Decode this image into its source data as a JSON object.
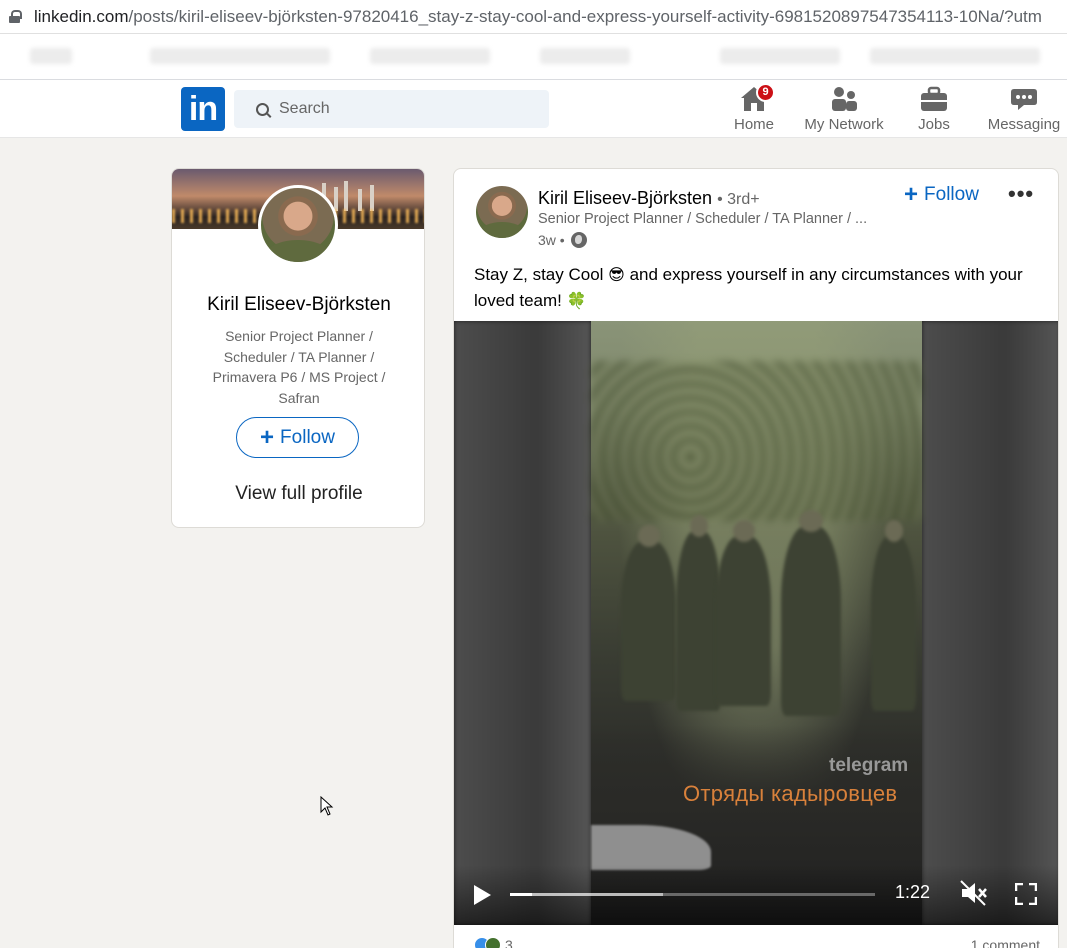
{
  "browser": {
    "url_host": "linkedin.com",
    "url_path": "/posts/kiril-eliseev-björksten-97820416_stay-z-stay-cool-and-express-yourself-activity-6981520897547354113-10Na/?utm"
  },
  "nav": {
    "logo_text": "in",
    "search_placeholder": "Search",
    "items": [
      {
        "label": "Home",
        "icon": "home-icon",
        "badge": "9"
      },
      {
        "label": "My Network",
        "icon": "network-icon"
      },
      {
        "label": "Jobs",
        "icon": "briefcase-icon"
      },
      {
        "label": "Messaging",
        "icon": "chat-icon"
      }
    ],
    "brand_color": "#0a66c2",
    "badge_color": "#cc1016"
  },
  "profile_card": {
    "name": "Kiril Eliseev-Björksten",
    "headline": "Senior Project Planner / Scheduler / TA Planner / Primavera P6 / MS Project / Safran",
    "follow_label": "Follow",
    "view_profile_label": "View full profile"
  },
  "post": {
    "author": "Kiril Eliseev-Björksten",
    "degree": "• 3rd+",
    "subtitle": "Senior Project Planner / Scheduler / TA Planner / ...",
    "age": "3w •",
    "follow_label": "Follow",
    "more_label": "•••",
    "text_part1": "Stay Z, stay Cool ",
    "emoji1": "😎",
    "text_part2": " and express yourself in any circumstances with your loved team! ",
    "emoji2": "🍀",
    "video": {
      "watermark_top": "telegram",
      "watermark_caption": "Отряды кадыровцев",
      "duration": "1:22",
      "progress": 0.06,
      "buffered": 0.42,
      "muted": true
    },
    "reactions_count": "3",
    "comments_label": "1 comment"
  }
}
